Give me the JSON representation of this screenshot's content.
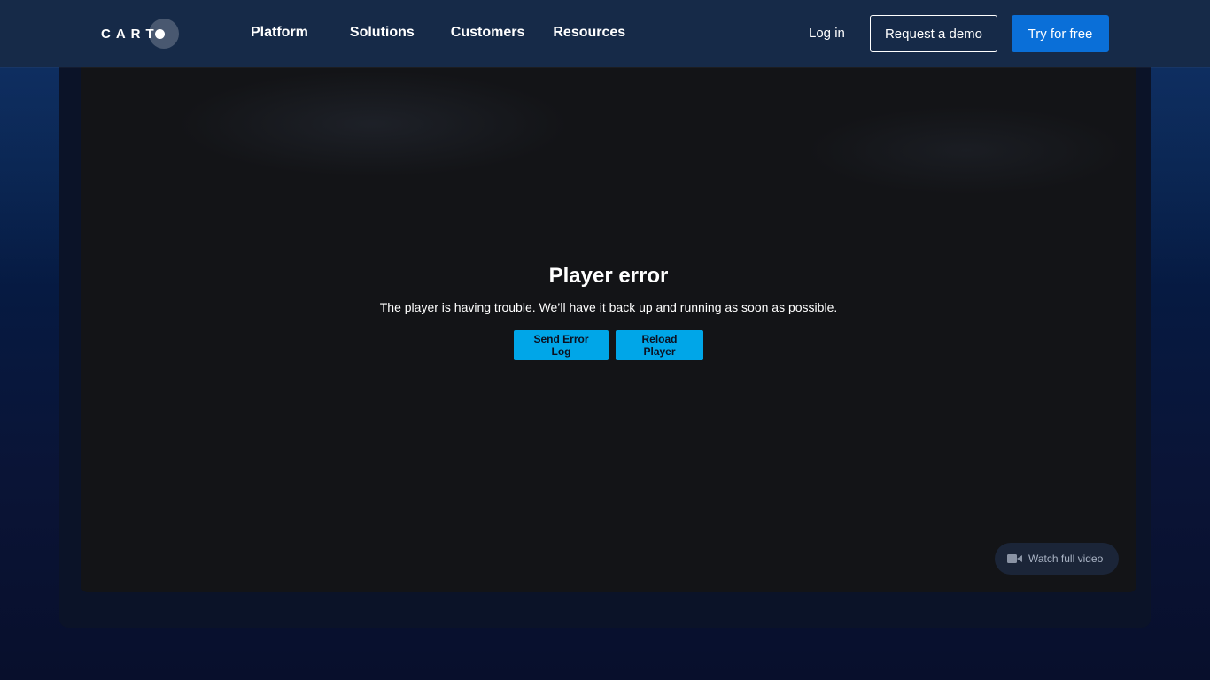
{
  "brand": {
    "logo_text": "CART"
  },
  "nav": {
    "items": [
      {
        "label": "Platform"
      },
      {
        "label": "Solutions"
      },
      {
        "label": "Customers"
      },
      {
        "label": "Resources"
      }
    ],
    "login_label": "Log in",
    "demo_label": "Request a demo",
    "try_label": "Try for free"
  },
  "player": {
    "error_title": "Player error",
    "error_message": "The player is having trouble. We’ll have it back up and running as soon as possible.",
    "send_log_label": "Send Error Log",
    "reload_label": "Reload Player",
    "watch_label": "Watch full video",
    "watch_icon": "video-camera-icon"
  },
  "colors": {
    "nav_background": "#162a48",
    "primary_button": "#0a6fd8",
    "player_button": "#00a6e8",
    "player_background": "#131417"
  }
}
